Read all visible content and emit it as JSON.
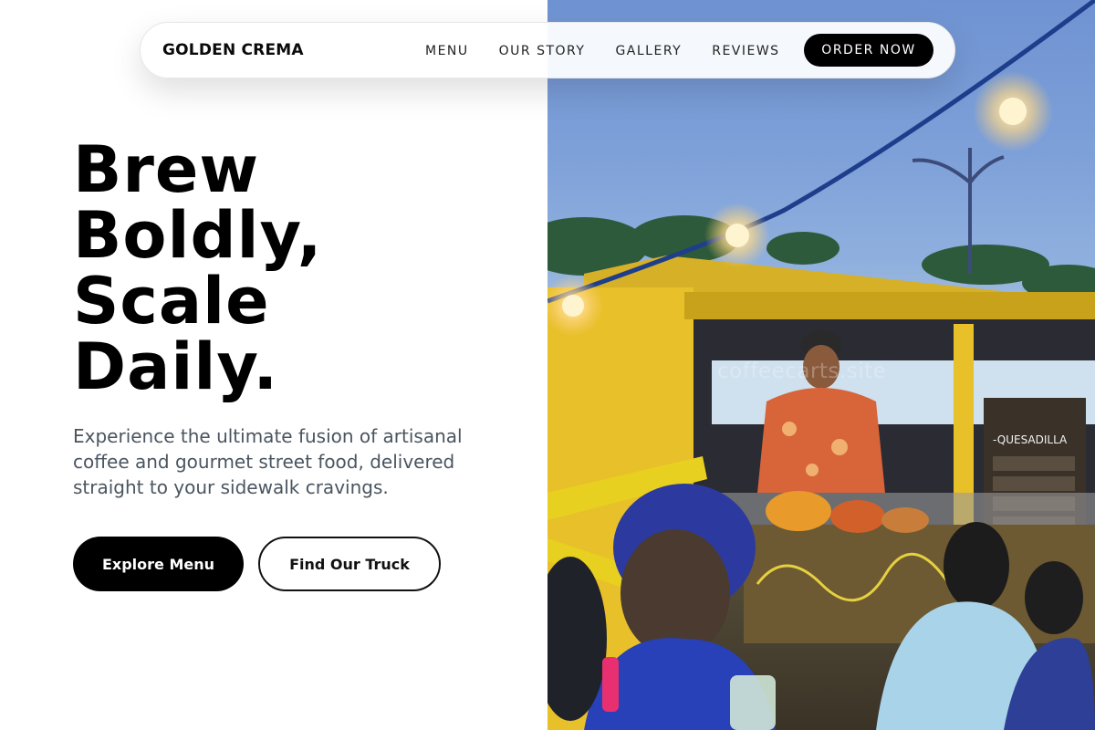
{
  "brand": {
    "name": "GOLDEN CREMA"
  },
  "nav": {
    "links": [
      "MENU",
      "OUR STORY",
      "GALLERY",
      "REVIEWS"
    ],
    "cta_label": "ORDER NOW"
  },
  "hero": {
    "title_lines": [
      "Brew",
      "Boldly,",
      "Scale",
      "Daily."
    ],
    "subtitle": "Experience the ultimate fusion of artisanal coffee and gourmet street food, delivered straight to your sidewalk cravings.",
    "primary_button": "Explore Menu",
    "secondary_button": "Find Our Truck"
  },
  "photo": {
    "watermark": "coffeecarts.site",
    "sign_text": "-QUESADILLA"
  },
  "colors": {
    "accent": "#000000",
    "subtitle_text": "#4a5560",
    "truck_yellow": "#e8c02a",
    "sky": "#7fa1d9"
  }
}
